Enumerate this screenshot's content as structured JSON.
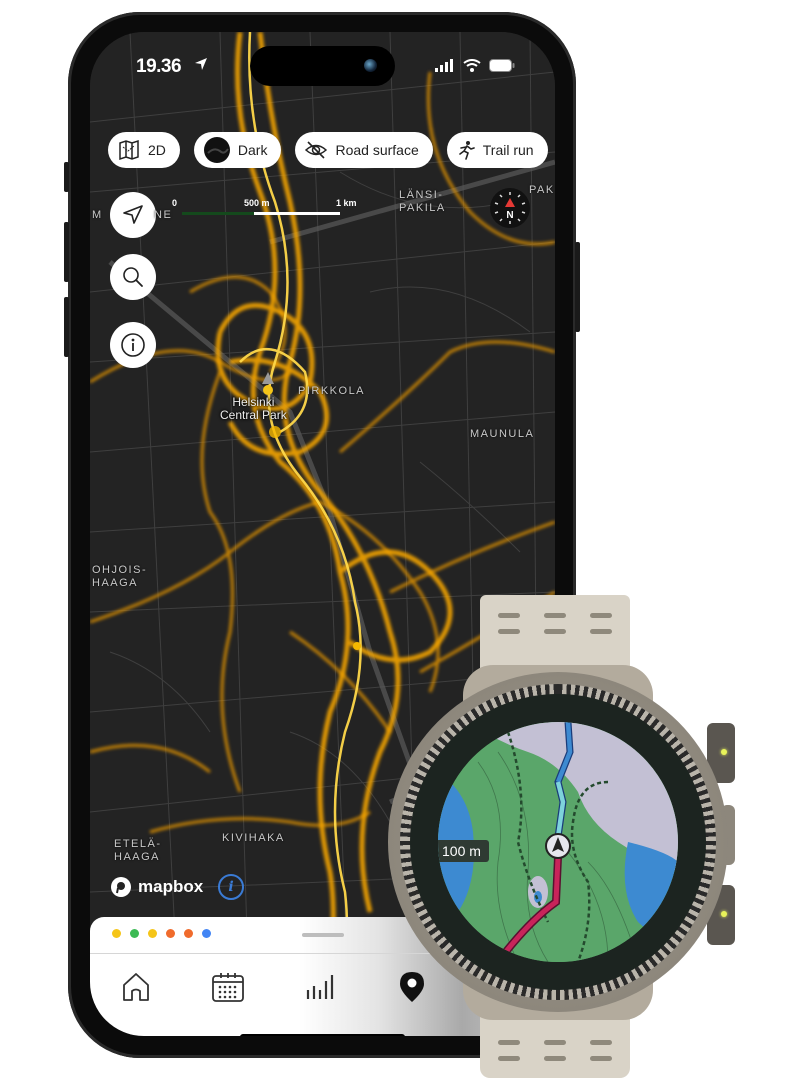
{
  "status_bar": {
    "time": "19.36",
    "icons": [
      "location-arrow-icon",
      "signal-icon",
      "wifi-icon",
      "battery-icon"
    ]
  },
  "chips": [
    {
      "label": "2D",
      "icon": "map-icon"
    },
    {
      "label": "Dark",
      "icon": "dark-style-icon"
    },
    {
      "label": "Road surface",
      "icon": "eye-off-icon"
    },
    {
      "label": "Trail run",
      "icon": "runner-icon"
    }
  ],
  "map_controls": [
    {
      "name": "locate",
      "icon": "navigation-arrow-icon"
    },
    {
      "name": "search",
      "icon": "search-icon"
    },
    {
      "name": "info",
      "icon": "info-icon"
    }
  ],
  "scale_bar": {
    "labels": [
      "0",
      "500 m",
      "1 km"
    ]
  },
  "compass": {
    "label": "N",
    "needle_color": "#e53935"
  },
  "map_labels": {
    "top_left": "M",
    "top_left2": "NE",
    "lansi_pakila": "LÄNSI-\nPAKILA",
    "pak": "PAK",
    "pirkkola": "PIRKKOLA",
    "park": "Helsinki\nCentral Park",
    "maunula": "MAUNULA",
    "pohjois_haaga": "OHJOIS-\nHAAGA",
    "etela_haaga": "ETELÄ-\nHAAGA",
    "kivihaka": "KIVIHAKA"
  },
  "attribution": {
    "brand": "mapbox",
    "info_glyph": "i"
  },
  "sheet": {
    "activity_dots": [
      "#f5c518",
      "#3cba54",
      "#f5c518",
      "#f06b2c",
      "#f06b2c",
      "#4285f4"
    ],
    "nav_items": [
      {
        "name": "home",
        "icon": "home-icon",
        "active": false
      },
      {
        "name": "calendar",
        "icon": "calendar-icon",
        "active": false
      },
      {
        "name": "stats",
        "icon": "stats-bars-icon",
        "active": false
      },
      {
        "name": "map",
        "icon": "map-pin-icon",
        "active": true
      }
    ]
  },
  "watch": {
    "scale_label": "100 m",
    "colors": {
      "forest": "#5aa66a",
      "open": "#c3c0d4",
      "water": "#3d8ad1",
      "route_ahead": "#7ed3dc",
      "route_behind": "#c8245a"
    }
  },
  "colors": {
    "heat": "#f5a500",
    "heat_bright": "#ffd84a",
    "map_bg": "#232323",
    "road": "#444444"
  }
}
